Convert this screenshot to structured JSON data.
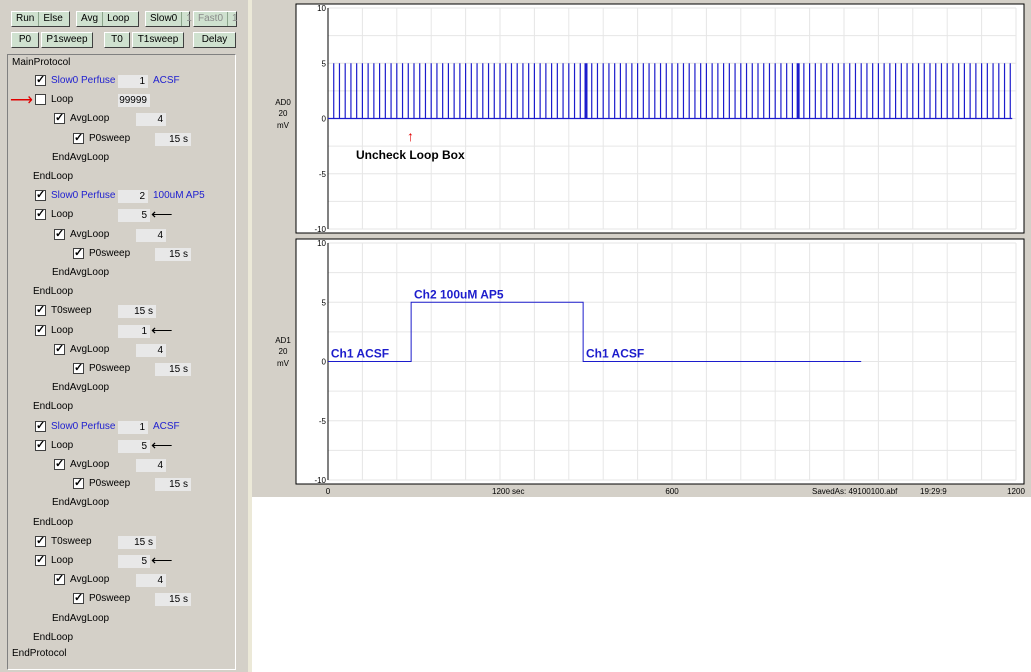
{
  "toolbar": {
    "row1": [
      {
        "label": "Run"
      },
      {
        "label": "Else"
      }
    ],
    "row1b": [
      {
        "label": "Avg"
      },
      {
        "label": "Loop"
      }
    ],
    "row1c": [
      {
        "label": "Slow0"
      },
      {
        "label": "1"
      }
    ],
    "row1d": [
      {
        "label": "Fast0"
      },
      {
        "label": "1"
      }
    ],
    "row2": [
      {
        "label": "P0"
      },
      {
        "label": "P1sweep"
      },
      {
        "label": "T0"
      },
      {
        "label": "T1sweep"
      },
      {
        "label": "Delay"
      }
    ]
  },
  "protocol": {
    "main": "MainProtocol",
    "end": "EndProtocol",
    "lines": [
      {
        "label": "Slow0 Perfuse",
        "value": "1",
        "note": "ACSF",
        "checked": true
      },
      {
        "label": "Loop",
        "value": "99999",
        "checked": false
      },
      {
        "label": "AvgLoop",
        "value": "4",
        "checked": true
      },
      {
        "label": "P0sweep",
        "value": "15 s",
        "checked": true
      },
      {
        "label": "EndAvgLoop"
      },
      {
        "label": "EndLoop"
      },
      {
        "label": "Slow0 Perfuse",
        "value": "2",
        "note": "100uM AP5",
        "checked": true
      },
      {
        "label": "Loop",
        "value": "5",
        "checked": true
      },
      {
        "label": "AvgLoop",
        "value": "4",
        "checked": true
      },
      {
        "label": "P0sweep",
        "value": "15 s",
        "checked": true
      },
      {
        "label": "EndAvgLoop"
      },
      {
        "label": "EndLoop"
      },
      {
        "label": "T0sweep",
        "value": "15 s",
        "checked": true
      },
      {
        "label": "Loop",
        "value": "1",
        "checked": true
      },
      {
        "label": "AvgLoop",
        "value": "4",
        "checked": true
      },
      {
        "label": "P0sweep",
        "value": "15 s",
        "checked": true
      },
      {
        "label": "EndAvgLoop"
      },
      {
        "label": "EndLoop"
      },
      {
        "label": "Slow0 Perfuse",
        "value": "1",
        "note": "ACSF",
        "checked": true
      },
      {
        "label": "Loop",
        "value": "5",
        "checked": true
      },
      {
        "label": "AvgLoop",
        "value": "4",
        "checked": true
      },
      {
        "label": "P0sweep",
        "value": "15 s",
        "checked": true
      },
      {
        "label": "EndAvgLoop"
      },
      {
        "label": "EndLoop"
      },
      {
        "label": "T0sweep",
        "value": "15 s",
        "checked": true
      },
      {
        "label": "Loop",
        "value": "5",
        "checked": true
      },
      {
        "label": "AvgLoop",
        "value": "4",
        "checked": true
      },
      {
        "label": "P0sweep",
        "value": "15 s",
        "checked": true
      },
      {
        "label": "EndAvgLoop"
      },
      {
        "label": "EndLoop"
      }
    ]
  },
  "annotation": "Uncheck Loop Box",
  "colors": {
    "trace": "#1c1ccc",
    "annot_arrow": "#e00000"
  },
  "chart_data": [
    {
      "type": "line",
      "channel_label": "AD0",
      "scale": "20",
      "unit": "mV",
      "xlim": [
        0,
        1200
      ],
      "ylim": [
        -10,
        10
      ],
      "yticks": [
        "10",
        "5",
        "0",
        "-5",
        "-10"
      ],
      "pulses_time": [
        10,
        20,
        30,
        40,
        50,
        60,
        70,
        80,
        90,
        100,
        110,
        120,
        130,
        140,
        150,
        160,
        170,
        180,
        190,
        200,
        210,
        220,
        230,
        240,
        250,
        260,
        270,
        280,
        290,
        300,
        310,
        320,
        330,
        340,
        350,
        360,
        370,
        380,
        390,
        400,
        410,
        420,
        430,
        440,
        450,
        460,
        470,
        480,
        490,
        500,
        510,
        520,
        530,
        540,
        550,
        560,
        570,
        580,
        590,
        600,
        610,
        620,
        630,
        640,
        650,
        660,
        670,
        680,
        690,
        700,
        710,
        720,
        730,
        740,
        750,
        760,
        770,
        780,
        790,
        800,
        810,
        820,
        830,
        840,
        850,
        860,
        870,
        880,
        890,
        900,
        910,
        920,
        930,
        940,
        950,
        960,
        970,
        980,
        990,
        1000,
        1010,
        1020,
        1030,
        1040,
        1050,
        1060,
        1070,
        1080,
        1090,
        1100,
        1110,
        1120,
        1130,
        1140,
        1150,
        1160,
        1170,
        1180,
        1190
      ],
      "pulse_height": 5,
      "series": [
        {
          "values": [
            0
          ]
        }
      ]
    },
    {
      "type": "line",
      "channel_label": "AD1",
      "scale": "20",
      "unit": "mV",
      "xlim": [
        0,
        1200
      ],
      "ylim": [
        -10,
        10
      ],
      "yticks": [
        "10",
        "5",
        "0",
        "-5",
        "-10"
      ],
      "xticks": [
        "0",
        "600",
        "1200"
      ],
      "x": [
        0,
        145,
        145,
        445,
        445,
        930
      ],
      "series": [
        {
          "values": [
            0,
            0,
            5,
            5,
            0,
            0
          ]
        }
      ],
      "annotations": [
        {
          "text": "Ch1  ACSF",
          "x": 5,
          "y": 0
        },
        {
          "text": "Ch2  100uM AP5",
          "x": 150,
          "y": 5
        },
        {
          "text": "Ch1  ACSF",
          "x": 450,
          "y": 0
        }
      ]
    }
  ],
  "status": {
    "duration": "1200 sec",
    "saved_as": "SavedAs: 49100100.abf",
    "time": "19:29:9"
  }
}
